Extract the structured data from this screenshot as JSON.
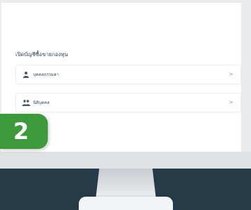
{
  "section": {
    "title": "เปิดบัญชีซื้อขายกองทุน"
  },
  "menu": [
    {
      "icon": "person-icon",
      "label": "บุคคลธรรมดา",
      "chevron": ">"
    },
    {
      "icon": "group-icon",
      "label": "นิติบุคคล",
      "chevron": ">"
    }
  ],
  "step": {
    "number": "2"
  },
  "colors": {
    "background": "#263a47",
    "step_badge": "#3c9a3a"
  }
}
